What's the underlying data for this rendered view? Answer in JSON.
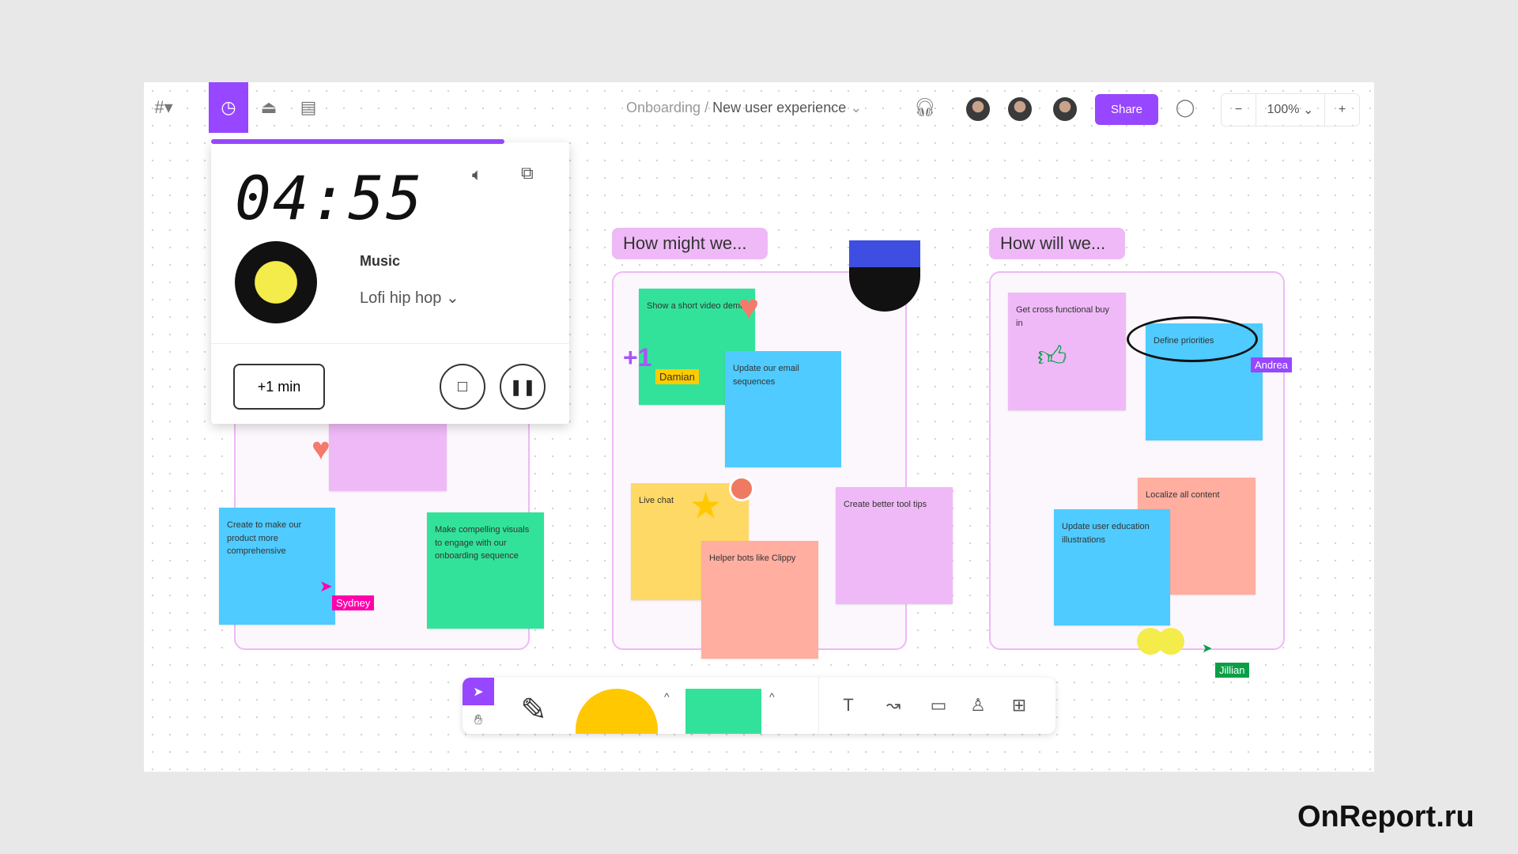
{
  "topbar": {
    "breadcrumb_parent": "Onboarding",
    "breadcrumb_sep": "/",
    "breadcrumb_current": "New user experience",
    "share_label": "Share",
    "zoom_level": "100%",
    "zoom_out": "−",
    "zoom_in": "+"
  },
  "timer": {
    "time": "04:55",
    "music_label": "Music",
    "genre": "Lofi hip hop",
    "add_minute": "+1 min",
    "progress": 0.82
  },
  "sections": [
    {
      "title": "How might we..."
    },
    {
      "title": "How will we..."
    }
  ],
  "stickies": {
    "left": [
      "",
      "Create to make our product more comprehensive",
      "Make compelling visuals to engage with our onboarding sequence"
    ],
    "middle": [
      "Show a short video demo",
      "Update our email sequences",
      "Live chat",
      "Helper bots like Clippy",
      "Create better tool tips"
    ],
    "right": [
      "Get cross functional buy in",
      "Define priorities",
      "Localize all content",
      "Update user education illustrations"
    ]
  },
  "cursors": {
    "damian": "Damian",
    "sydney": "Sydney",
    "andrea": "Andrea",
    "jillian": "Jillian"
  },
  "watermark": "OnReport.ru",
  "colors": {
    "accent": "#9747ff",
    "pink": "#efb9f7",
    "blue": "#4fcbff",
    "green": "#33e29a",
    "yellow": "#ffd966",
    "salmon": "#ffaea0"
  }
}
